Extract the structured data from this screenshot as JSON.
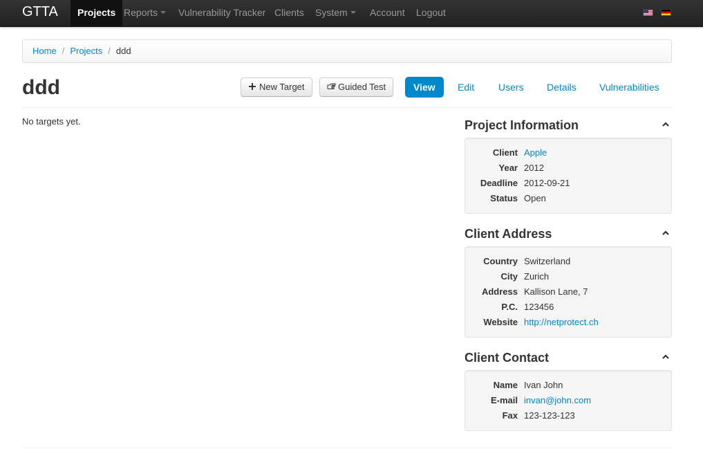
{
  "navbar": {
    "brand": "GTTA",
    "items": [
      {
        "label": "Projects"
      },
      {
        "label": "Reports"
      },
      {
        "label": "Vulnerability Tracker"
      },
      {
        "label": "Clients"
      },
      {
        "label": "System"
      },
      {
        "label": "Account"
      },
      {
        "label": "Logout"
      }
    ],
    "languages": [
      "us-flag-icon",
      "german-flag-icon"
    ]
  },
  "breadcrumb": [
    "Home",
    "Projects",
    "ddd"
  ],
  "page": {
    "title": "ddd",
    "buttons": {
      "new_target": "New Target",
      "guided_test": "Guided Test"
    },
    "tabs": [
      "View",
      "Edit",
      "Users",
      "Details",
      "Vulnerabilities"
    ],
    "empty_message": "No targets yet."
  },
  "project_info": {
    "title": "Project Information",
    "rows": [
      {
        "key": "Client",
        "value": "Apple"
      },
      {
        "key": "Year",
        "value": "2012"
      },
      {
        "key": "Deadline",
        "value": "2012-09-21"
      },
      {
        "key": "Status",
        "value": "Open"
      }
    ]
  },
  "client_address": {
    "title": "Client Address",
    "rows": [
      {
        "key": "Country",
        "value": "Switzerland"
      },
      {
        "key": "City",
        "value": "Zurich"
      },
      {
        "key": "Address",
        "value": "Kallison Lane, 7"
      },
      {
        "key": "P.C.",
        "value": "123456"
      },
      {
        "key": "Website",
        "value": "http://netprotect.ch"
      }
    ]
  },
  "client_contact": {
    "title": "Client Contact",
    "rows": [
      {
        "key": "Name",
        "value": "Ivan John"
      },
      {
        "key": "E-mail",
        "value": "invan@john.com"
      },
      {
        "key": "Fax",
        "value": "123-123-123"
      }
    ]
  },
  "colors": {
    "accent": "#0088cc",
    "navbar": "#222222",
    "well": "#f5f5f5"
  }
}
